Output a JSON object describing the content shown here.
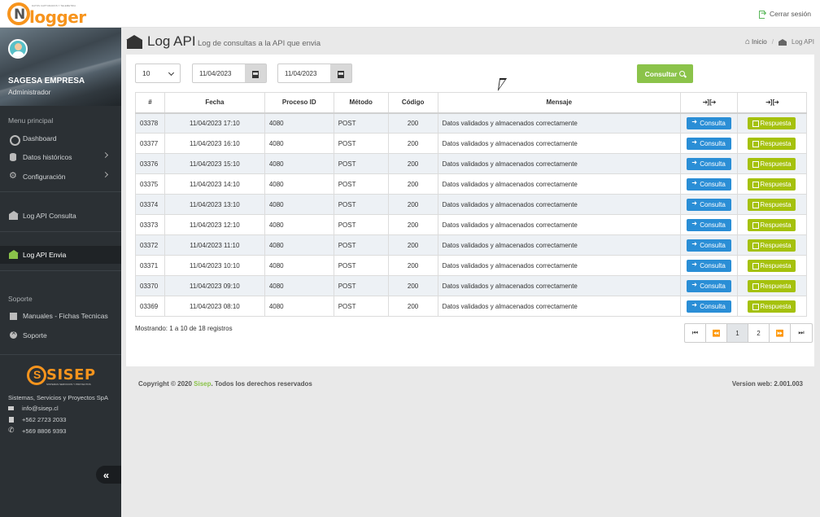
{
  "app": {
    "logo_text": "logger",
    "logo_letter": "N",
    "logo_tagline": "DATOS CAPTURADOS Y TELEMETRIA",
    "logout_label": "Cerrar sesión"
  },
  "sidebar": {
    "user_name": "SAGESA EMPRESA",
    "user_role": "Administrador",
    "section_main": "Menu principal",
    "items": [
      {
        "label": "Dashboard",
        "icon": "dashboard-icon"
      },
      {
        "label": "Datos históricos",
        "icon": "database-icon"
      },
      {
        "label": "Configuración",
        "icon": "gear-icon"
      },
      {
        "label": "Log API Consulta",
        "icon": "bank-icon"
      },
      {
        "label": "Log API Envia",
        "icon": "bank-icon",
        "active": true
      }
    ],
    "section_support": "Soporte",
    "support_items": [
      {
        "label": "Manuales - Fichas Tecnicas",
        "icon": "book-icon"
      },
      {
        "label": "Soporte",
        "icon": "help-icon"
      }
    ],
    "company_logo": "SISEP",
    "company_logo_sub": "SISTEMAS SERVICIOS Y PROYECTOS",
    "company_name": "Sistemas, Servicios y Proyectos SpA",
    "email": "info@sisep.cl",
    "fax": "+562 2723 2033",
    "phone": "+569 8806 9393",
    "collapse_label": "«"
  },
  "header": {
    "title": "Log API",
    "subtitle": "Log de consultas a la API que envia",
    "breadcrumb_home": "Inicio",
    "breadcrumb_separator": "/",
    "breadcrumb_current": "Log API"
  },
  "filters": {
    "page_size": "10",
    "date_from": "11/04/2023",
    "date_to": "11/04/2023",
    "consultar_label": "Consultar"
  },
  "table": {
    "headers": [
      "#",
      "Fecha",
      "Proceso ID",
      "Método",
      "Código",
      "Mensaje",
      "➜] [➜",
      "➜] [➜"
    ],
    "consulta_label": "Consulta",
    "respuesta_label": "Respuesta",
    "rows": [
      {
        "id": "03378",
        "fecha": "11/04/2023 17:10",
        "proceso": "4080",
        "metodo": "POST",
        "codigo": "200",
        "mensaje": "Datos validados y almacenados correctamente"
      },
      {
        "id": "03377",
        "fecha": "11/04/2023 16:10",
        "proceso": "4080",
        "metodo": "POST",
        "codigo": "200",
        "mensaje": "Datos validados y almacenados correctamente"
      },
      {
        "id": "03376",
        "fecha": "11/04/2023 15:10",
        "proceso": "4080",
        "metodo": "POST",
        "codigo": "200",
        "mensaje": "Datos validados y almacenados correctamente"
      },
      {
        "id": "03375",
        "fecha": "11/04/2023 14:10",
        "proceso": "4080",
        "metodo": "POST",
        "codigo": "200",
        "mensaje": "Datos validados y almacenados correctamente"
      },
      {
        "id": "03374",
        "fecha": "11/04/2023 13:10",
        "proceso": "4080",
        "metodo": "POST",
        "codigo": "200",
        "mensaje": "Datos validados y almacenados correctamente"
      },
      {
        "id": "03373",
        "fecha": "11/04/2023 12:10",
        "proceso": "4080",
        "metodo": "POST",
        "codigo": "200",
        "mensaje": "Datos validados y almacenados correctamente"
      },
      {
        "id": "03372",
        "fecha": "11/04/2023 11:10",
        "proceso": "4080",
        "metodo": "POST",
        "codigo": "200",
        "mensaje": "Datos validados y almacenados correctamente"
      },
      {
        "id": "03371",
        "fecha": "11/04/2023 10:10",
        "proceso": "4080",
        "metodo": "POST",
        "codigo": "200",
        "mensaje": "Datos validados y almacenados correctamente"
      },
      {
        "id": "03370",
        "fecha": "11/04/2023 09:10",
        "proceso": "4080",
        "metodo": "POST",
        "codigo": "200",
        "mensaje": "Datos validados y almacenados correctamente"
      },
      {
        "id": "03369",
        "fecha": "11/04/2023 08:10",
        "proceso": "4080",
        "metodo": "POST",
        "codigo": "200",
        "mensaje": "Datos validados y almacenados correctamente"
      }
    ]
  },
  "pagination": {
    "info": "Mostrando: 1 a 10 de 18 registros",
    "first": "⏮",
    "prev": "⏪",
    "pages": [
      "1",
      "2"
    ],
    "next": "⏩",
    "last": "⏭"
  },
  "footer": {
    "copyright_prefix": "Copyright © 2020 ",
    "brand": "Sisep",
    "copyright_suffix": ". Todos los derechos reservados",
    "version": "Version web: 2.001.003"
  },
  "colors": {
    "accent_green": "#8bc34a",
    "button_blue": "#2a8ed6",
    "button_olive": "#a5c10c",
    "sidebar_bg": "#2b3034",
    "logo_orange": "#f7941d"
  }
}
